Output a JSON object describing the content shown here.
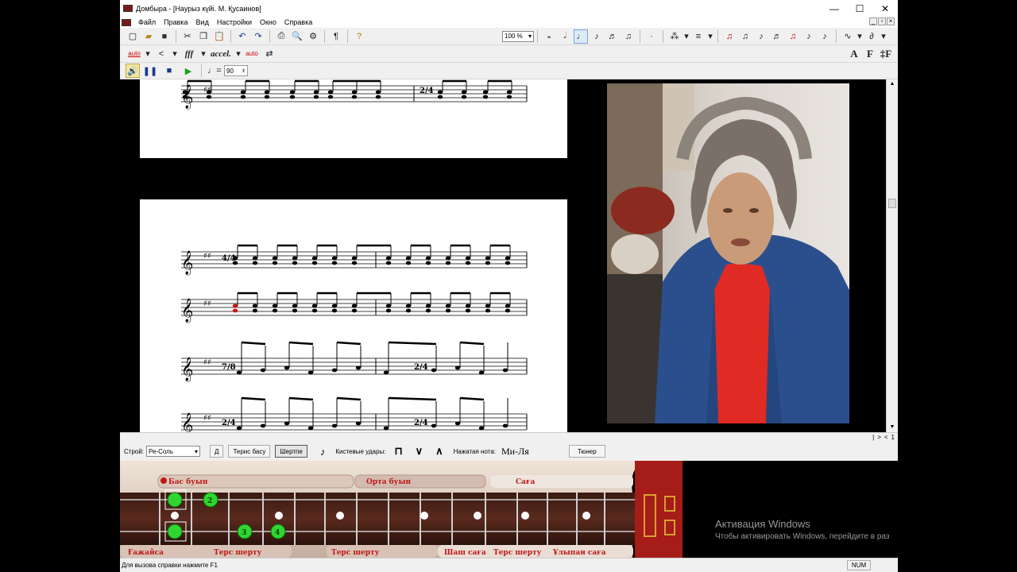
{
  "window": {
    "title": "Домбыра - [Наурыз күйі. М. Қусаинов]"
  },
  "window_controls": {
    "minimize": "—",
    "maximize": "☐",
    "close": "✕"
  },
  "menu": [
    "Файл",
    "Правка",
    "Вид",
    "Настройки",
    "Окно",
    "Справка"
  ],
  "toolbar": {
    "zoom": "100 %",
    "auto_label": "auto",
    "accel_label": "accel.",
    "dynamics_label": "fff",
    "tempo_value": "90",
    "font_buttons": [
      "A",
      "F",
      "‡F"
    ]
  },
  "tuning_bar": {
    "tuning_label": "Строй:",
    "tuning_value": "Ре-Соль",
    "d_button": "Д",
    "reverse_bass_button": "Терис басу",
    "shertpe_button": "Шертпе",
    "strokes_label": "Кистевые удары:",
    "pressed_note_label": "Нажатая нота:",
    "pressed_note_value": "Ми-Ля",
    "tuner_button": "Тюнер"
  },
  "fretboard": {
    "top_labels": [
      "Бас буын",
      "Орта буын",
      "Саға"
    ],
    "bottom_labels": [
      "Ғажайса",
      "Терс шерту",
      "Терс шерту",
      "Шаш саға",
      "Терс шерту",
      "Ұлыпан саға"
    ],
    "fingers": [
      "2",
      "3",
      "4"
    ]
  },
  "score": {
    "time_sigs": [
      "2/4",
      "4/4",
      "7/8",
      "2/4",
      "7/8",
      "2/4"
    ]
  },
  "hscroll_buttons": [
    "|",
    ">",
    "<",
    "1"
  ],
  "status": {
    "help": "Для вызова справки нажмите F1",
    "num": "NUM"
  },
  "activation": {
    "title": "Активация Windows",
    "subtitle": "Чтобы активировать Windows, перейдите в раз"
  }
}
